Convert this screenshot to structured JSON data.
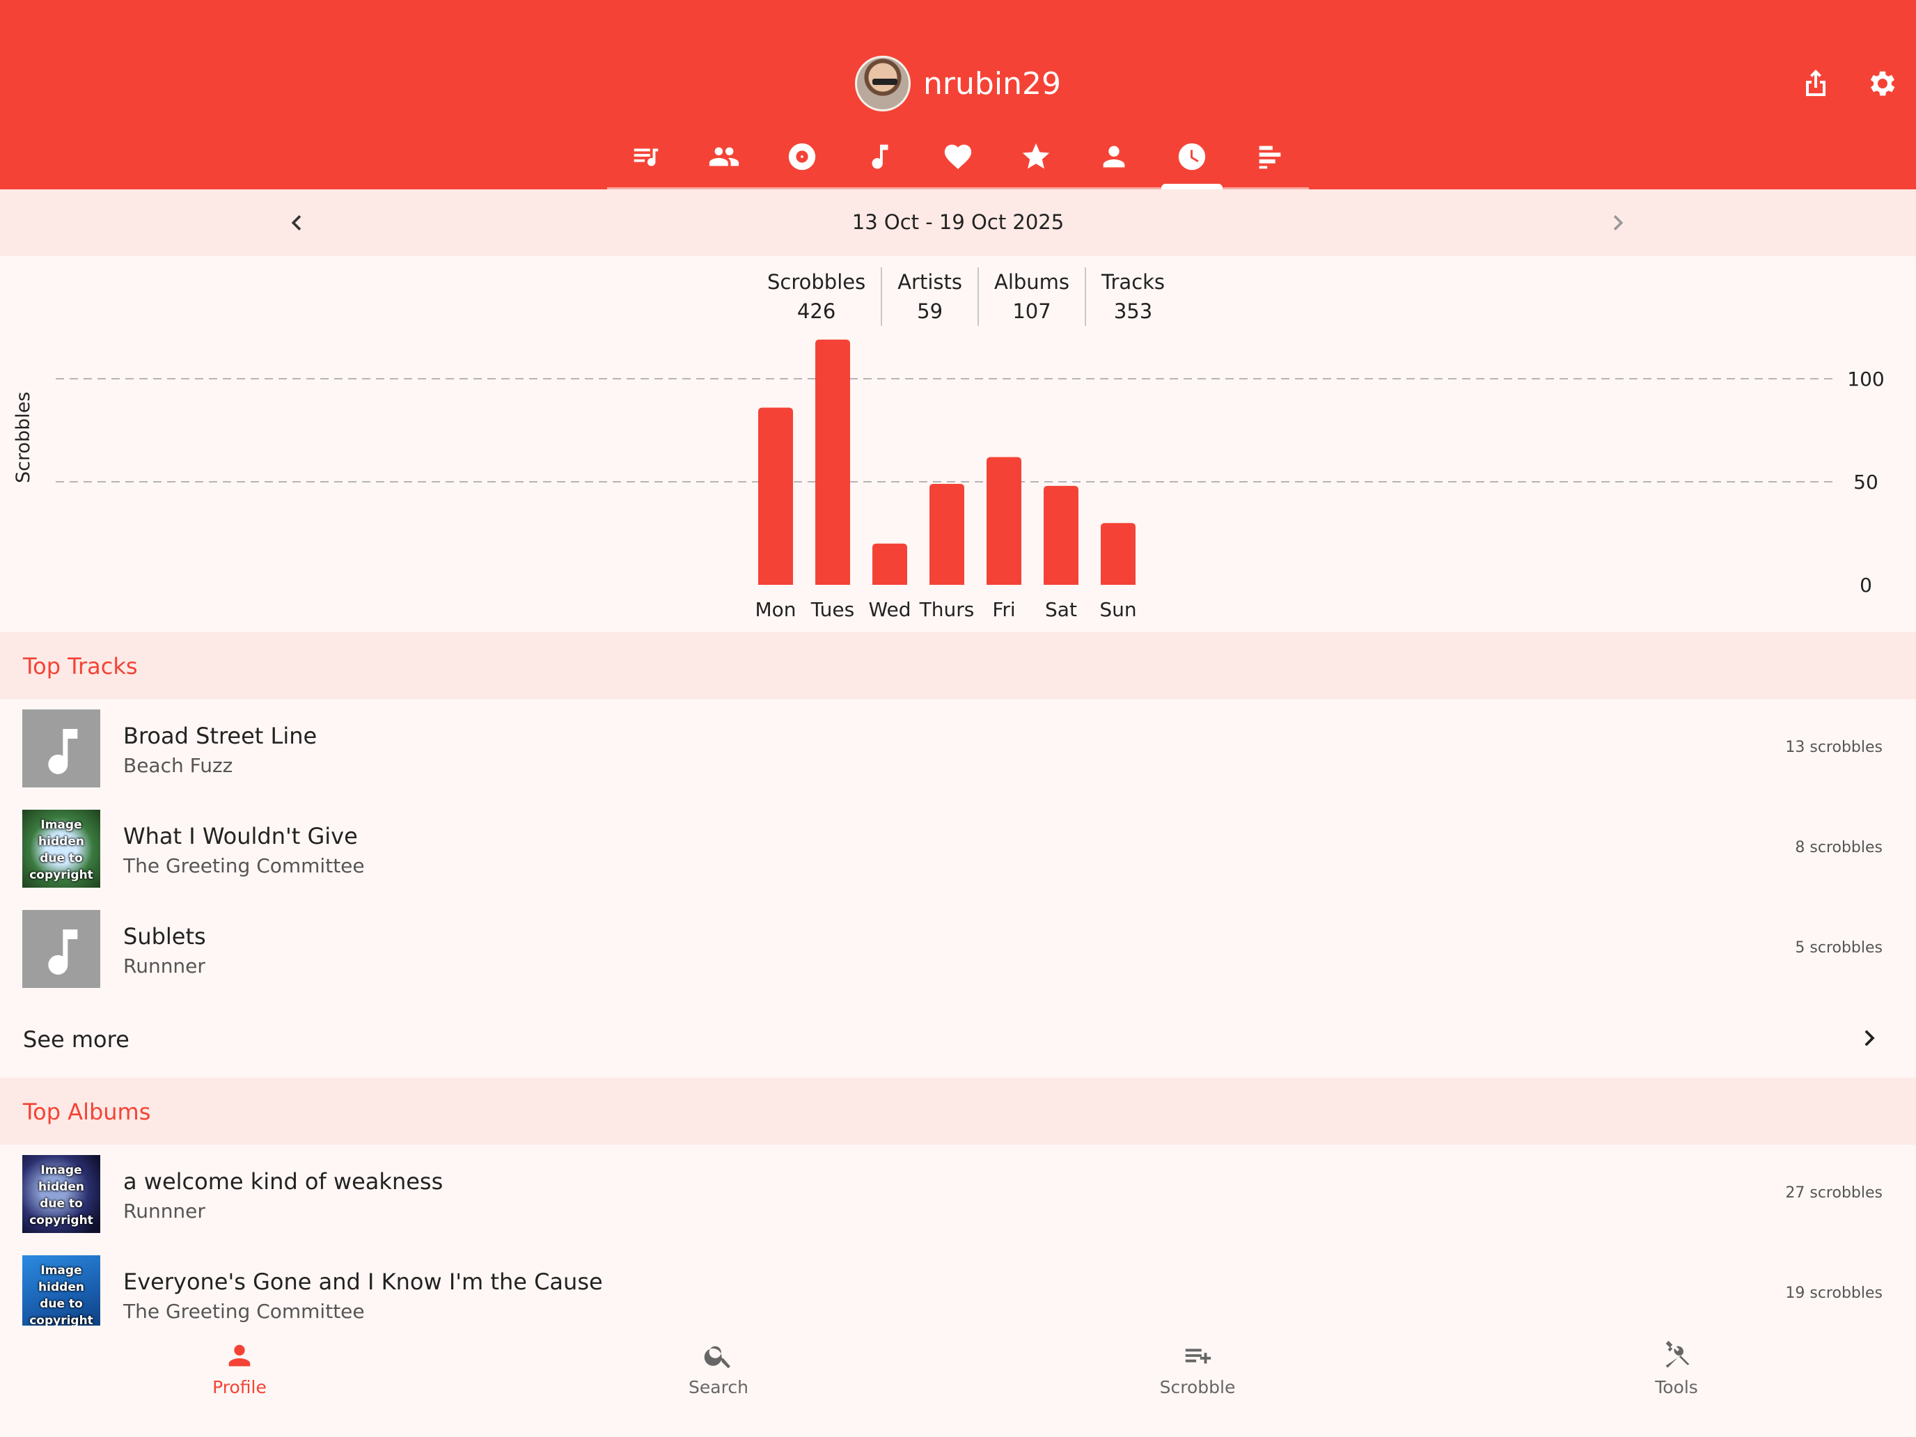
{
  "header": {
    "username": "nrubin29",
    "tabs": [
      "playlist-icon",
      "friends-icon",
      "album-icon",
      "music-note-icon",
      "heart-icon",
      "star-icon",
      "person-icon",
      "clock-icon",
      "bar-chart-icon"
    ],
    "active_tab": "clock-icon",
    "accent_color": "#f44336"
  },
  "period": {
    "label": "13 Oct - 19 Oct 2025"
  },
  "stats": [
    {
      "label": "Scrobbles",
      "value": "426"
    },
    {
      "label": "Artists",
      "value": "59"
    },
    {
      "label": "Albums",
      "value": "107"
    },
    {
      "label": "Tracks",
      "value": "353"
    }
  ],
  "chart_data": {
    "type": "bar",
    "categories": [
      "Mon",
      "Tues",
      "Wed",
      "Thurs",
      "Fri",
      "Sat",
      "Sun"
    ],
    "values": [
      86,
      119,
      20,
      49,
      62,
      48,
      30
    ],
    "ylabel": "Scrobbles",
    "yticks": [
      0,
      50,
      100
    ],
    "ylim": [
      0,
      100
    ],
    "grid": true,
    "color": "#f44336"
  },
  "top_tracks": {
    "title": "Top Tracks",
    "items": [
      {
        "title": "Broad Street Line",
        "artist": "Beach Fuzz",
        "count": "13 scrobbles",
        "thumb": "note"
      },
      {
        "title": "What I Wouldn't Give",
        "artist": "The Greeting Committee",
        "count": "8 scrobbles",
        "thumb": "art",
        "art_text": [
          "Image",
          "hidden",
          "due to",
          "copyright"
        ],
        "art_bg": "radial-gradient(circle at 50% 50%, #cfe9ff 0 22px, #3b7a3f 45px, #1e3f1c 80px)"
      },
      {
        "title": "Sublets",
        "artist": "Runnner",
        "count": "5 scrobbles",
        "thumb": "note"
      }
    ],
    "see_more": "See more"
  },
  "top_albums": {
    "title": "Top Albums",
    "items": [
      {
        "title": "a welcome kind of weakness",
        "artist": "Runnner",
        "count": "27 scrobbles",
        "thumb": "art",
        "art_text": [
          "Image",
          "hidden",
          "due to",
          "copyright"
        ],
        "art_bg": "radial-gradient(circle at 40% 45%, #8fa3d6 0 18px, #2a2f6e 50px, #0e0f2b 80px)"
      },
      {
        "title": "Everyone's Gone and I Know I'm the Cause",
        "artist": "The Greeting Committee",
        "count": "19 scrobbles",
        "thumb": "art",
        "art_text": [
          "Image",
          "hidden",
          "due to",
          "copyright"
        ],
        "art_bg": "linear-gradient(160deg, #2b8be0 0%, #1a5fb0 55%, #0c3a78 100%)"
      }
    ]
  },
  "bottom_nav": [
    {
      "label": "Profile",
      "icon": "person-icon",
      "active": true
    },
    {
      "label": "Search",
      "icon": "search-icon",
      "active": false
    },
    {
      "label": "Scrobble",
      "icon": "playlist-add-icon",
      "active": false
    },
    {
      "label": "Tools",
      "icon": "tools-icon",
      "active": false
    }
  ]
}
